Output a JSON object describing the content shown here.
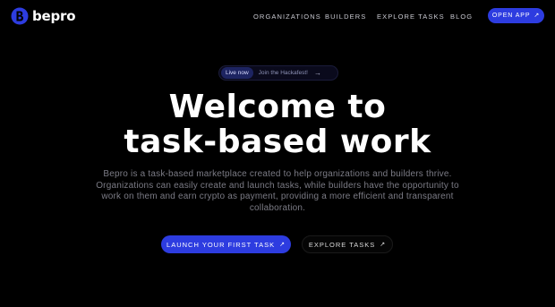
{
  "brand": {
    "name": "bepro",
    "accent": "#2d3ce0"
  },
  "nav": {
    "links": [
      "ORGANIZATIONS",
      "BUILDERS",
      "EXPLORE TASKS",
      "BLOG"
    ],
    "cta_label": "OPEN APP",
    "cta_icon": "arrow-up-right-icon"
  },
  "announcement": {
    "badge": "Live now",
    "text": "Join the Hackafest!",
    "icon": "arrow-right-icon"
  },
  "hero": {
    "title_line1": "Welcome to",
    "title_line2": "task-based work",
    "description": "Bepro is a task-based marketplace created to help organizations and builders thrive. Organizations can easily create and launch tasks, while builders have the opportunity to work on them and earn crypto as payment, providing a more efficient and transparent collaboration."
  },
  "actions": {
    "primary_label": "LAUNCH YOUR FIRST TASK",
    "secondary_label": "EXPLORE TASKS",
    "icon": "arrow-up-right-icon"
  }
}
